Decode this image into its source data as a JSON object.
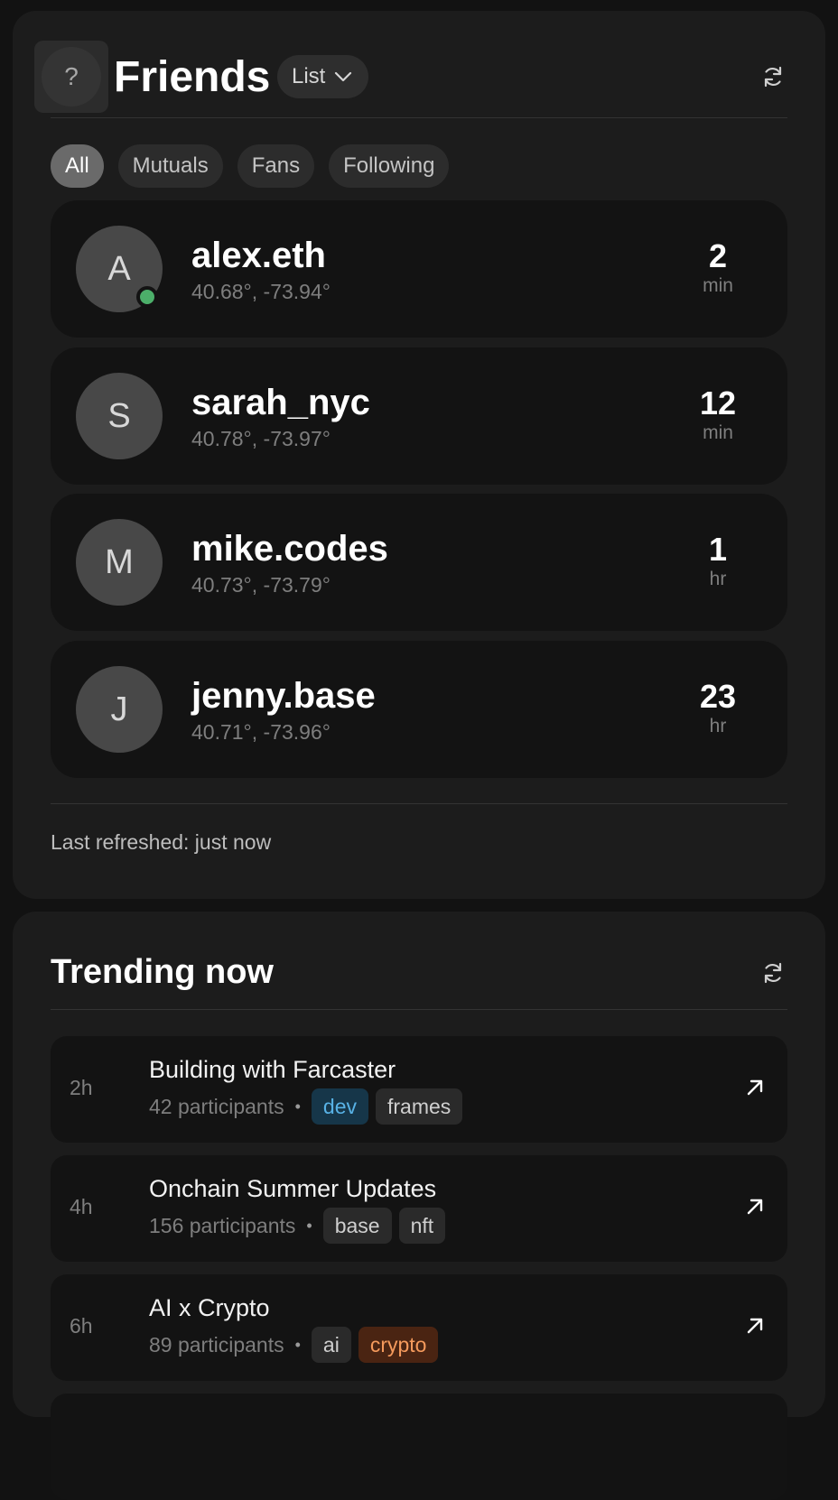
{
  "friends": {
    "help_label": "?",
    "title": "Friends",
    "view_selector": "List",
    "filters": [
      "All",
      "Mutuals",
      "Fans",
      "Following"
    ],
    "active_filter": "All",
    "items": [
      {
        "initial": "A",
        "name": "alex.eth",
        "coords": "40.68°, -73.94°",
        "time_value": "2",
        "time_unit": "min",
        "online": true
      },
      {
        "initial": "S",
        "name": "sarah_nyc",
        "coords": "40.78°, -73.97°",
        "time_value": "12",
        "time_unit": "min",
        "online": false
      },
      {
        "initial": "M",
        "name": "mike.codes",
        "coords": "40.73°, -73.79°",
        "time_value": "1",
        "time_unit": "hr",
        "online": false
      },
      {
        "initial": "J",
        "name": "jenny.base",
        "coords": "40.71°, -73.96°",
        "time_value": "23",
        "time_unit": "hr",
        "online": false
      }
    ],
    "last_refreshed": "Last refreshed: just now"
  },
  "trending": {
    "title": "Trending now",
    "items": [
      {
        "age": "2h",
        "title": "Building with Farcaster",
        "participants": "42 participants",
        "tags": [
          {
            "label": "dev",
            "color": "#58b2e6"
          },
          {
            "label": "frames",
            "color": "#cfcfcf"
          }
        ]
      },
      {
        "age": "4h",
        "title": "Onchain Summer Updates",
        "participants": "156 participants",
        "tags": [
          {
            "label": "base",
            "color": "#cfcfcf"
          },
          {
            "label": "nft",
            "color": "#cfcfcf"
          }
        ]
      },
      {
        "age": "6h",
        "title": "AI x Crypto",
        "participants": "89 participants",
        "tags": [
          {
            "label": "ai",
            "color": "#cfcfcf"
          },
          {
            "label": "crypto",
            "color": "#f59a5c"
          }
        ]
      }
    ]
  },
  "colors": {
    "background": "#121212",
    "card": "#1c1c1c",
    "row": "#131313",
    "online": "#4caf6a",
    "tag_blue": "#58b2e6",
    "tag_orange": "#f59a5c"
  },
  "icons": {
    "help": "question-mark-icon",
    "dropdown": "chevron-down-icon",
    "refresh": "refresh-icon",
    "open_link": "arrow-up-right-icon"
  }
}
